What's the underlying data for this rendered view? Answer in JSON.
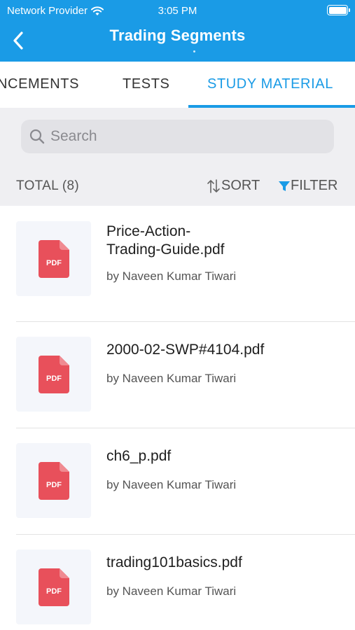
{
  "status_bar": {
    "carrier": "Network Provider",
    "time": "3:05 PM"
  },
  "nav": {
    "title": "Trading Segments"
  },
  "tabs": [
    {
      "label": "NCEMENTS"
    },
    {
      "label": "TESTS"
    },
    {
      "label": "STUDY MATERIAL",
      "active": true
    }
  ],
  "search": {
    "placeholder": "Search"
  },
  "toolbar": {
    "total": "TOTAL (8)",
    "sort": "SORT",
    "filter": "FILTER"
  },
  "items": [
    {
      "name_line1": "Price-Action-",
      "name_line2": "Trading-Guide.pdf",
      "author": "by Naveen Kumar Tiwari",
      "icon": "pdf-icon",
      "icon_label": "PDF"
    },
    {
      "name_line1": "2000-02-SWP#4104.pdf",
      "name_line2": "",
      "author": "by Naveen Kumar Tiwari",
      "icon": "pdf-icon",
      "icon_label": "PDF"
    },
    {
      "name_line1": "ch6_p.pdf",
      "name_line2": "",
      "author": "by Naveen Kumar Tiwari",
      "icon": "pdf-icon",
      "icon_label": "PDF"
    },
    {
      "name_line1": "trading101basics.pdf",
      "name_line2": "",
      "author": "by Naveen Kumar Tiwari",
      "icon": "pdf-icon",
      "icon_label": "PDF"
    }
  ],
  "colors": {
    "accent": "#1a9be6",
    "pdf": "#e8505b",
    "background": "#efeff2"
  }
}
